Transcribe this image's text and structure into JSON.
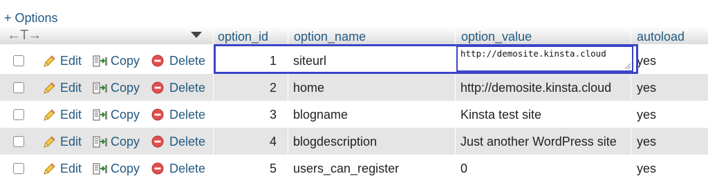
{
  "options_link": "+ Options",
  "header": {
    "arrows": "←T→",
    "columns": {
      "option_id": "option_id",
      "option_name": "option_name",
      "option_value": "option_value",
      "autoload": "autoload"
    }
  },
  "actions": {
    "edit": "Edit",
    "copy": "Copy",
    "delete": "Delete"
  },
  "rows": [
    {
      "option_id": "1",
      "option_name": "siteurl",
      "option_value": "http://demosite.kinsta.cloud",
      "autoload": "yes",
      "editing": true
    },
    {
      "option_id": "2",
      "option_name": "home",
      "option_value": "http://demosite.kinsta.cloud",
      "autoload": "yes"
    },
    {
      "option_id": "3",
      "option_name": "blogname",
      "option_value": "Kinsta test site",
      "autoload": "yes"
    },
    {
      "option_id": "4",
      "option_name": "blogdescription",
      "option_value": "Just another WordPress site",
      "autoload": "yes"
    },
    {
      "option_id": "5",
      "option_name": "users_can_register",
      "option_value": "0",
      "autoload": "yes"
    }
  ],
  "colors": {
    "link": "#235a81",
    "highlight": "#3a44c8",
    "row_alt": "#e5e5e5"
  },
  "icons": {
    "edit": "pencil-icon",
    "copy": "copy-icon",
    "delete": "delete-icon"
  }
}
